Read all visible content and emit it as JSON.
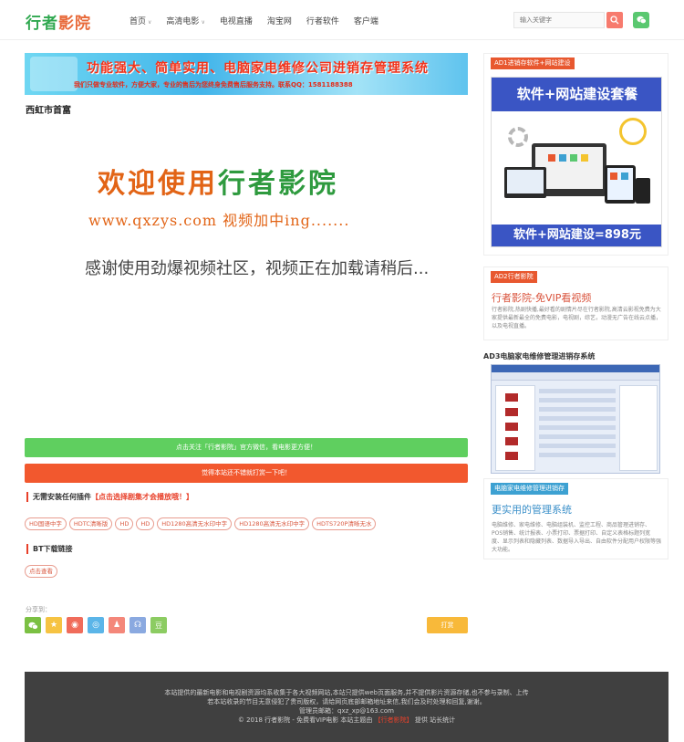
{
  "header": {
    "logo_part1": "行者",
    "logo_part2": "影院",
    "nav": [
      {
        "label": "首页",
        "dropdown": true
      },
      {
        "label": "高清电影",
        "dropdown": true
      },
      {
        "label": "电视直播",
        "dropdown": false
      },
      {
        "label": "淘宝网",
        "dropdown": false
      },
      {
        "label": "行者软件",
        "dropdown": false
      },
      {
        "label": "客户端",
        "dropdown": false
      }
    ],
    "search_placeholder": "输入关键字",
    "search_icon": "search-icon",
    "wechat_icon": "wechat-icon"
  },
  "banner": {
    "headline": "功能强大、简单实用、电脑家电维修公司进销存管理系统",
    "subline": "我们只做专业软件，方便大家，专业的售后为您终身免费售后服务支持。联系QQ：1581188388"
  },
  "video": {
    "title": "西虹市首富",
    "welcome_part1": "欢迎使用",
    "welcome_part2": "行者影院",
    "url_text": "www.qxzys.com 视频加中ing.......",
    "loading_text": "感谢使用劲爆视频社区，视频正在加载请稍后..."
  },
  "buttons": {
    "follow": "点击关注「行者影院」官方微信，看电影更方便！",
    "tip": "觉得本站还不错就打赏一下吧！"
  },
  "play_section": {
    "title_prefix": "无需安装任何插件",
    "title_highlight": "【点击选择剧集才会播放哦！】",
    "tags": [
      "HD国语中字",
      "HDTC清晰版",
      "HD",
      "HD",
      "HD1280高清无水印中字",
      "HD1280高清无水印中字",
      "HDTS720P清晰无水"
    ]
  },
  "bt_section": {
    "title": "BT下载链接",
    "tag": "点击查看"
  },
  "share": {
    "label": "分享到：",
    "icons": [
      {
        "name": "wechat-share-icon",
        "glyph": "💬",
        "color": "#7bc043"
      },
      {
        "name": "qzone-share-icon",
        "glyph": "★",
        "color": "#f6c342"
      },
      {
        "name": "weibo-share-icon",
        "glyph": "◉",
        "color": "#f06c5b"
      },
      {
        "name": "tencent-weibo-share-icon",
        "glyph": "◎",
        "color": "#5bb5e8"
      },
      {
        "name": "douban-person-share-icon",
        "glyph": "♟",
        "color": "#f4877a"
      },
      {
        "name": "renren-share-icon",
        "glyph": "☊",
        "color": "#8aa9e0"
      },
      {
        "name": "douban-share-icon",
        "glyph": "豆",
        "color": "#8ccc62"
      }
    ],
    "tip_button": "打赏"
  },
  "sidebar": {
    "ad1_tag": "AD1进销存软件+网站建设",
    "ad1_head": "软件+网站建设套餐",
    "ad1_foot": "软件+网站建设=898元",
    "ad2_tag": "AD2行者影院",
    "ad2_title": "行者影院-免VIP看视频",
    "ad2_desc": "行者影院,热剧快播,最好看的剧情片尽在行者影院,高清云影视免费为大家提供最新最全的免费电影，电视剧，综艺，动漫无广告在线云点播，以及电视直播。",
    "ad3_title": "AD3电脑家电维修管理进销存系统",
    "ad4_tag": "电脑家电维修管理进销存",
    "ad4_title": "更实用的管理系统",
    "ad4_desc": "电脑维修、家电维修、电脑组装机、监控工程、商品管理进销存、POS销售、统计报表、小票打印、票据打印、自定义表格标题列宽度、显示列表和隐藏列表、数据导入导出、自由软件分配用户权限等强大功能。"
  },
  "footer": {
    "line1": "本站提供的最新电影和电视剧资源均系收集于各大视频网站,本站只提供web页面服务,并不提供影片资源存储,也不参与录制、上传",
    "line2": "若本站收录的节目无意侵犯了贵司版权，请给网页底部邮箱地址来信,我们会及时处理和回复,谢谢。",
    "line3": "管理员邮箱：qxz_xp@163.com",
    "line4_prefix": "© 2018 行者影院 - 免费看VIP电影 本站主题由",
    "line4_link": "【行者影院】",
    "line4_suffix": "提供 站长统计"
  },
  "colors": {
    "brand_green": "#2fa84f",
    "brand_orange": "#e86a3a",
    "follow_button": "#5fcf5f",
    "tip_button_red": "#f2582e",
    "reward_button": "#f8b93a",
    "footer_bg": "#404040"
  }
}
